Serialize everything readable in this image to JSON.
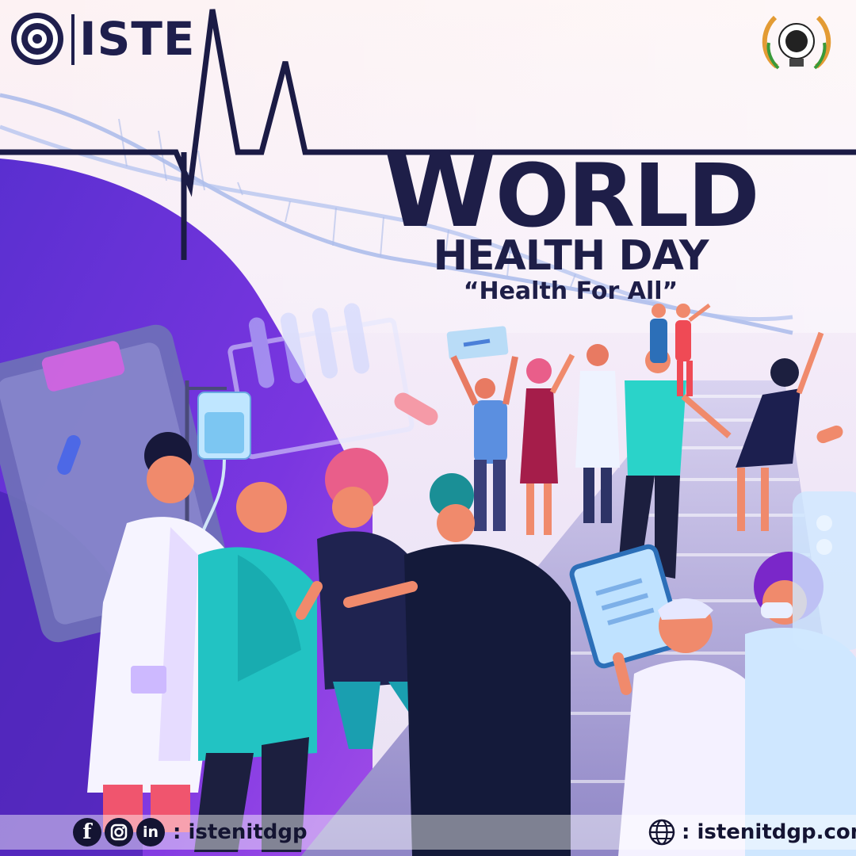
{
  "header": {
    "org_wordmark": "ISTE"
  },
  "title": {
    "world_initial": "W",
    "world_rest": "ORLD",
    "line2": "HEALTH DAY",
    "theme": "“Health For All”"
  },
  "footer": {
    "social_handle": ": istenitdgp",
    "website": ": istenitdgp.com"
  },
  "colors": {
    "navy": "#1e1e48",
    "violet": "#6d2fd8",
    "teal": "#22c3c3",
    "coral": "#f0556e",
    "crimson": "#a51d4a"
  },
  "icons": [
    "facebook-icon",
    "instagram-icon",
    "linkedin-icon",
    "globe-icon",
    "heartbeat-line",
    "iv-drip-icon",
    "clipboard-icon"
  ]
}
